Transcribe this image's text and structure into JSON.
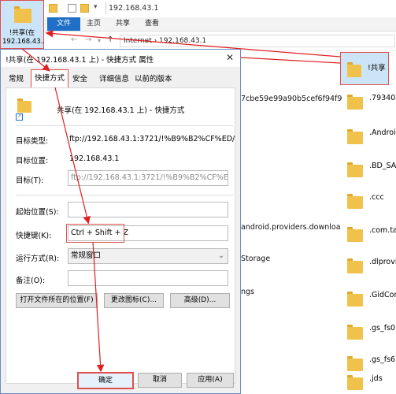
{
  "desktop_icon": {
    "label": "!共享(在 192.168.43..."
  },
  "explorer": {
    "title": "192.168.43.1",
    "ribbon_tabs": [
      "文件",
      "主页",
      "共享",
      "查看"
    ],
    "breadcrumb": "Internet  ›  192.168.43.1",
    "list_items": [
      "!共享",
      ".793403",
      ".Android",
      ".BD_SAF",
      ".ccc",
      ".com.tac",
      ".dlprovic",
      ".GidCon",
      ".gs_fs0",
      ".gs_fs6",
      ".jds"
    ],
    "middle_fragments": [
      "7cbe59e99a90b5cef6f94f9",
      "android.providers.downloa",
      "Storage",
      "ngs"
    ]
  },
  "dialog": {
    "title": "!共享(在 192.168.43.1 上) - 快捷方式 属性",
    "close": "✕",
    "tabs": [
      "常规",
      "快捷方式",
      "安全",
      "详细信息",
      "以前的版本"
    ],
    "header_name": "共享(在 192.168.43.1 上) - 快捷方式",
    "target_type_label": "目标类型:",
    "target_type_value": "ftp://192.168.43.1:3721/!%B9%B2%CF%ED/",
    "target_loc_label": "目标位置:",
    "target_loc_value": "192.168.43.1",
    "target_label": "目标(T):",
    "target_value": "ftp://192.168.43.1:3721/!%B9%B2%CF%ED/",
    "start_label": "起始位置(S):",
    "start_value": "",
    "hotkey_label": "快捷键(K):",
    "hotkey_value": "Ctrl + Shift + Z",
    "run_label": "运行方式(R):",
    "run_value": "常规窗口",
    "comment_label": "备注(O):",
    "comment_value": "",
    "btn_open_location": "打开文件所在的位置(F)",
    "btn_change_icon": "更改图标(C)...",
    "btn_advanced": "高级(D)...",
    "btn_ok": "确定",
    "btn_cancel": "取消",
    "btn_apply": "应用(A)"
  },
  "colors": {
    "accent": "#1e6fc5",
    "highlight_border": "#e05050",
    "folder": "#f1c24b"
  }
}
